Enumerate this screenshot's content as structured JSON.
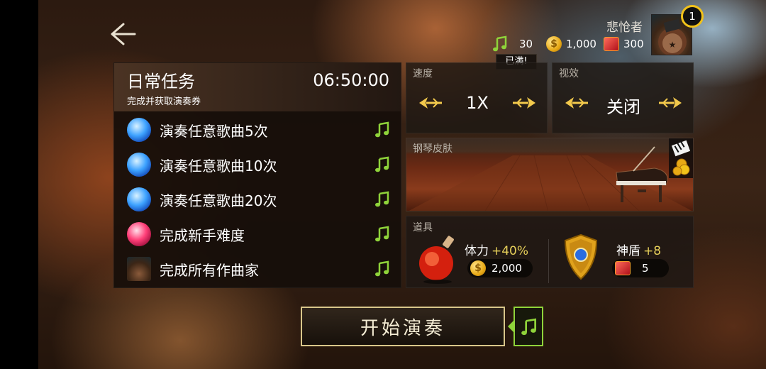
{
  "header": {
    "player_name": "悲怆者",
    "level": "1",
    "resources": {
      "notes": "30",
      "gold": "1,000",
      "rubies": "300",
      "notes_status": "已满!"
    }
  },
  "daily_tasks": {
    "title": "日常任务",
    "subtitle": "完成并获取演奏券",
    "timer": "06:50:00",
    "items": [
      {
        "label": "演奏任意歌曲5次",
        "icon": "blue-gem-icon"
      },
      {
        "label": "演奏任意歌曲10次",
        "icon": "blue-gem-icon"
      },
      {
        "label": "演奏任意歌曲20次",
        "icon": "blue-gem-icon"
      },
      {
        "label": "完成新手难度",
        "icon": "red-gem-icon"
      },
      {
        "label": "完成所有作曲家",
        "icon": "composer-avatar-icon"
      }
    ]
  },
  "speed": {
    "label": "速度",
    "value": "1X"
  },
  "visual": {
    "label": "视效",
    "value": "关闭"
  },
  "piano_skin": {
    "label": "钢琴皮肤"
  },
  "items": {
    "label": "道具",
    "stamina": {
      "name": "体力",
      "bonus": "+40%",
      "cost": "2,000"
    },
    "shield": {
      "name": "神盾",
      "bonus": "+8",
      "cost": "5"
    }
  },
  "start_button": {
    "label": "开始演奏"
  },
  "colors": {
    "accent_green": "#8fd33a",
    "gold": "#f2c21a",
    "bonus_yellow": "#e7d05a"
  }
}
